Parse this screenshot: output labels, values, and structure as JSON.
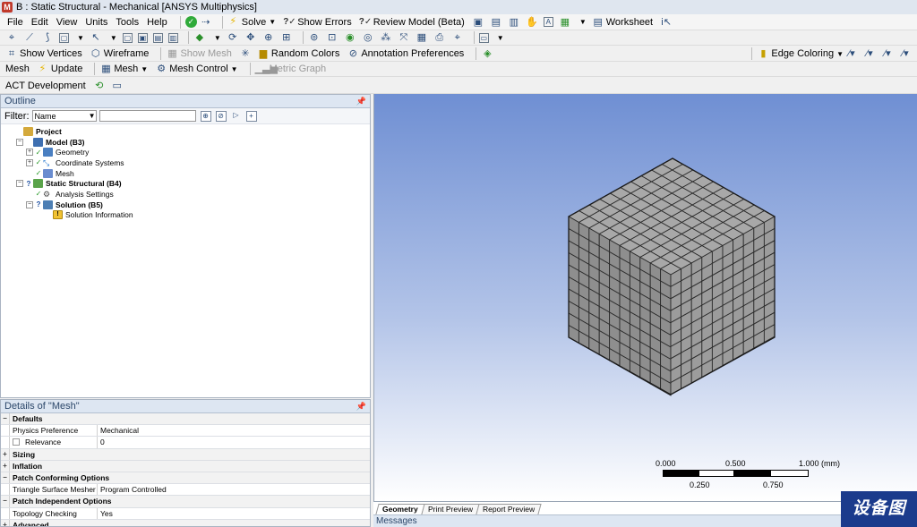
{
  "window": {
    "title": "B : Static Structural - Mechanical [ANSYS Multiphysics]",
    "logo_letter": "M"
  },
  "menu": [
    "File",
    "Edit",
    "View",
    "Units",
    "Tools",
    "Help"
  ],
  "toolbar_main": {
    "solve": "Solve",
    "show_errors": "Show Errors",
    "review_model": "Review Model (Beta)",
    "worksheet": "Worksheet"
  },
  "toolbar_graphics": {
    "show_vertices": "Show Vertices",
    "wireframe": "Wireframe",
    "show_mesh": "Show Mesh",
    "random_colors": "Random Colors",
    "annotation_preferences": "Annotation Preferences",
    "edge_coloring": "Edge Coloring"
  },
  "toolbar_mesh": {
    "mesh_label": "Mesh",
    "update": "Update",
    "mesh": "Mesh",
    "mesh_control": "Mesh Control",
    "metric_graph": "Metric Graph"
  },
  "toolbar_act": {
    "act_development": "ACT Development"
  },
  "outline": {
    "header": "Outline",
    "filter_label": "Filter:",
    "filter_value": "Name",
    "tree": [
      {
        "label": "Project",
        "bold": true,
        "expander": "",
        "status": "",
        "icon": "project"
      },
      {
        "label": "Model (B3)",
        "bold": true,
        "expander": "-",
        "status": "",
        "icon": "model"
      },
      {
        "label": "Geometry",
        "bold": false,
        "expander": "+",
        "status": "ok",
        "icon": "geo"
      },
      {
        "label": "Coordinate Systems",
        "bold": false,
        "expander": "+",
        "status": "ok",
        "icon": "coord"
      },
      {
        "label": "Mesh",
        "bold": false,
        "expander": "",
        "status": "ok",
        "icon": "mesh"
      },
      {
        "label": "Static Structural (B4)",
        "bold": true,
        "expander": "-",
        "status": "q",
        "icon": "static"
      },
      {
        "label": "Analysis Settings",
        "bold": false,
        "expander": "",
        "status": "ok",
        "icon": "analysis"
      },
      {
        "label": "Solution (B5)",
        "bold": true,
        "expander": "-",
        "status": "q",
        "icon": "solution"
      },
      {
        "label": "Solution Information",
        "bold": false,
        "expander": "",
        "status": "",
        "icon": "info"
      }
    ]
  },
  "details": {
    "header": "Details of \"Mesh\"",
    "rows": [
      {
        "type": "group",
        "toggle": "-",
        "key": "Defaults"
      },
      {
        "type": "prop",
        "key": "Physics Preference",
        "value": "Mechanical",
        "checkbox": false
      },
      {
        "type": "prop",
        "key": "Relevance",
        "value": "0",
        "checkbox": true
      },
      {
        "type": "group",
        "toggle": "+",
        "key": "Sizing"
      },
      {
        "type": "group",
        "toggle": "+",
        "key": "Inflation"
      },
      {
        "type": "group",
        "toggle": "-",
        "key": "Patch Conforming Options"
      },
      {
        "type": "prop",
        "key": "Triangle Surface Mesher",
        "value": "Program Controlled",
        "checkbox": false
      },
      {
        "type": "group",
        "toggle": "-",
        "key": "Patch Independent Options"
      },
      {
        "type": "prop",
        "key": "Topology Checking",
        "value": "Yes",
        "checkbox": false
      },
      {
        "type": "group",
        "toggle": "+",
        "key": "Advanced"
      }
    ]
  },
  "scale": {
    "labels_top": [
      "0.000",
      "0.500",
      "1.000 (mm)"
    ],
    "labels_bottom": [
      "0.250",
      "0.750"
    ]
  },
  "view_tabs": [
    "Geometry",
    "Print Preview",
    "Report Preview"
  ],
  "active_view_tab": "Geometry",
  "messages_label": "Messages",
  "watermark": "设备图"
}
